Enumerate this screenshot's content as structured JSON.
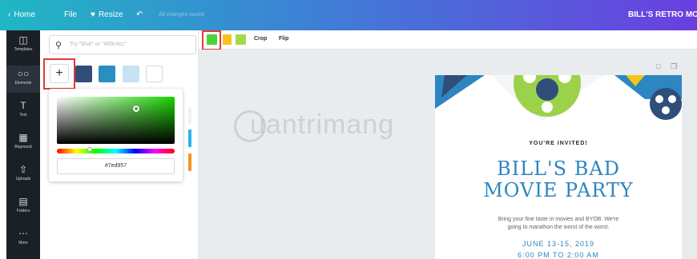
{
  "topbar": {
    "home": "Home",
    "file": "File",
    "resize": "Resize",
    "saved_status": "All changes saved",
    "design_title": "BILL'S RETRO MOVIE I"
  },
  "rail": [
    {
      "label": "Templates",
      "icon": "templates-icon"
    },
    {
      "label": "Elements",
      "icon": "elements-icon"
    },
    {
      "label": "Text",
      "icon": "text-icon"
    },
    {
      "label": "Bkground",
      "icon": "background-icon"
    },
    {
      "label": "Uploads",
      "icon": "uploads-icon"
    },
    {
      "label": "Folders",
      "icon": "folders-icon"
    },
    {
      "label": "More",
      "icon": "more-icon"
    }
  ],
  "panel": {
    "search_placeholder": "Try \"blue\" or \"#00c4cc\"",
    "add_label": "+",
    "swatches": [
      "#2f4e7a",
      "#2a8fc0",
      "#c5e3f4",
      "#ffffff"
    ],
    "hex_value": "#7ed957",
    "side_peek_colors": [
      "#ffffff",
      "#29b5e8",
      "#f7941d"
    ]
  },
  "toolbar": {
    "swatches": [
      "#4cd137",
      "#f5c518",
      "#a6d94a"
    ],
    "crop": "Crop",
    "flip": "Flip"
  },
  "card": {
    "invited": "YOU'RE INVITED!",
    "title_line1": "BILL'S BAD",
    "title_line2": "MOVIE PARTY",
    "body_line1": "Bring your fine taste in movies and BYOB. We're",
    "body_line2": "going to marathon the worst of the worst.",
    "date": "JUNE 13-15, 2019",
    "time": "6:00 PM TO 2:00 AM"
  },
  "watermark": "uantrimang",
  "colors": {
    "accent_red": "#e03a3a",
    "title_blue": "#2e86c1"
  }
}
